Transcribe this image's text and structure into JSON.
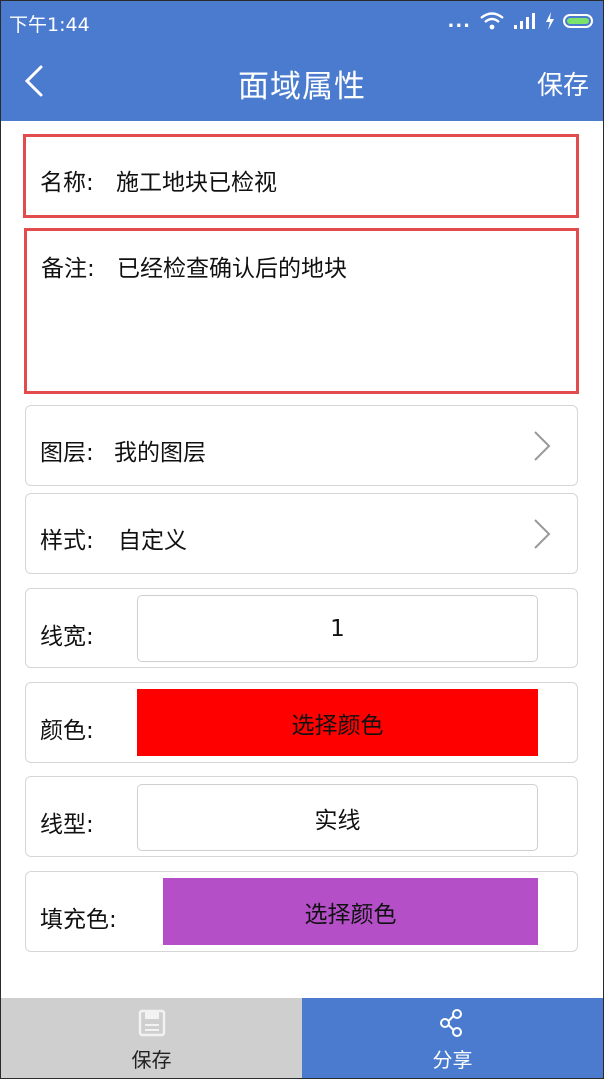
{
  "status_bar": {
    "time": "下午1:44",
    "dots": "...",
    "battery_color": "#7be36b"
  },
  "header": {
    "title": "面域属性",
    "save_label": "保存",
    "background": "#4a7bcf"
  },
  "form": {
    "name": {
      "label": "名称:",
      "value": "施工地块已检视"
    },
    "note": {
      "label": "备注:",
      "value": "已经检查确认后的地块"
    },
    "layer": {
      "label": "图层:",
      "value": "我的图层"
    },
    "style": {
      "label": "样式:",
      "value": "自定义"
    },
    "line_width": {
      "label": "线宽:",
      "value": "1"
    },
    "color": {
      "label": "颜色:",
      "button_label": "选择颜色",
      "swatch": "#ff0000"
    },
    "line_type": {
      "label": "线型:",
      "value": "实线"
    },
    "fill_color": {
      "label": "填充色:",
      "button_label": "选择颜色",
      "swatch": "#b44fc8"
    }
  },
  "bottom_bar": {
    "save": {
      "label": "保存",
      "icon": "save-disk-icon"
    },
    "share": {
      "label": "分享",
      "icon": "share-icon"
    }
  },
  "colors": {
    "highlight_border": "#e24c4c",
    "accent": "#4a7bcf"
  }
}
